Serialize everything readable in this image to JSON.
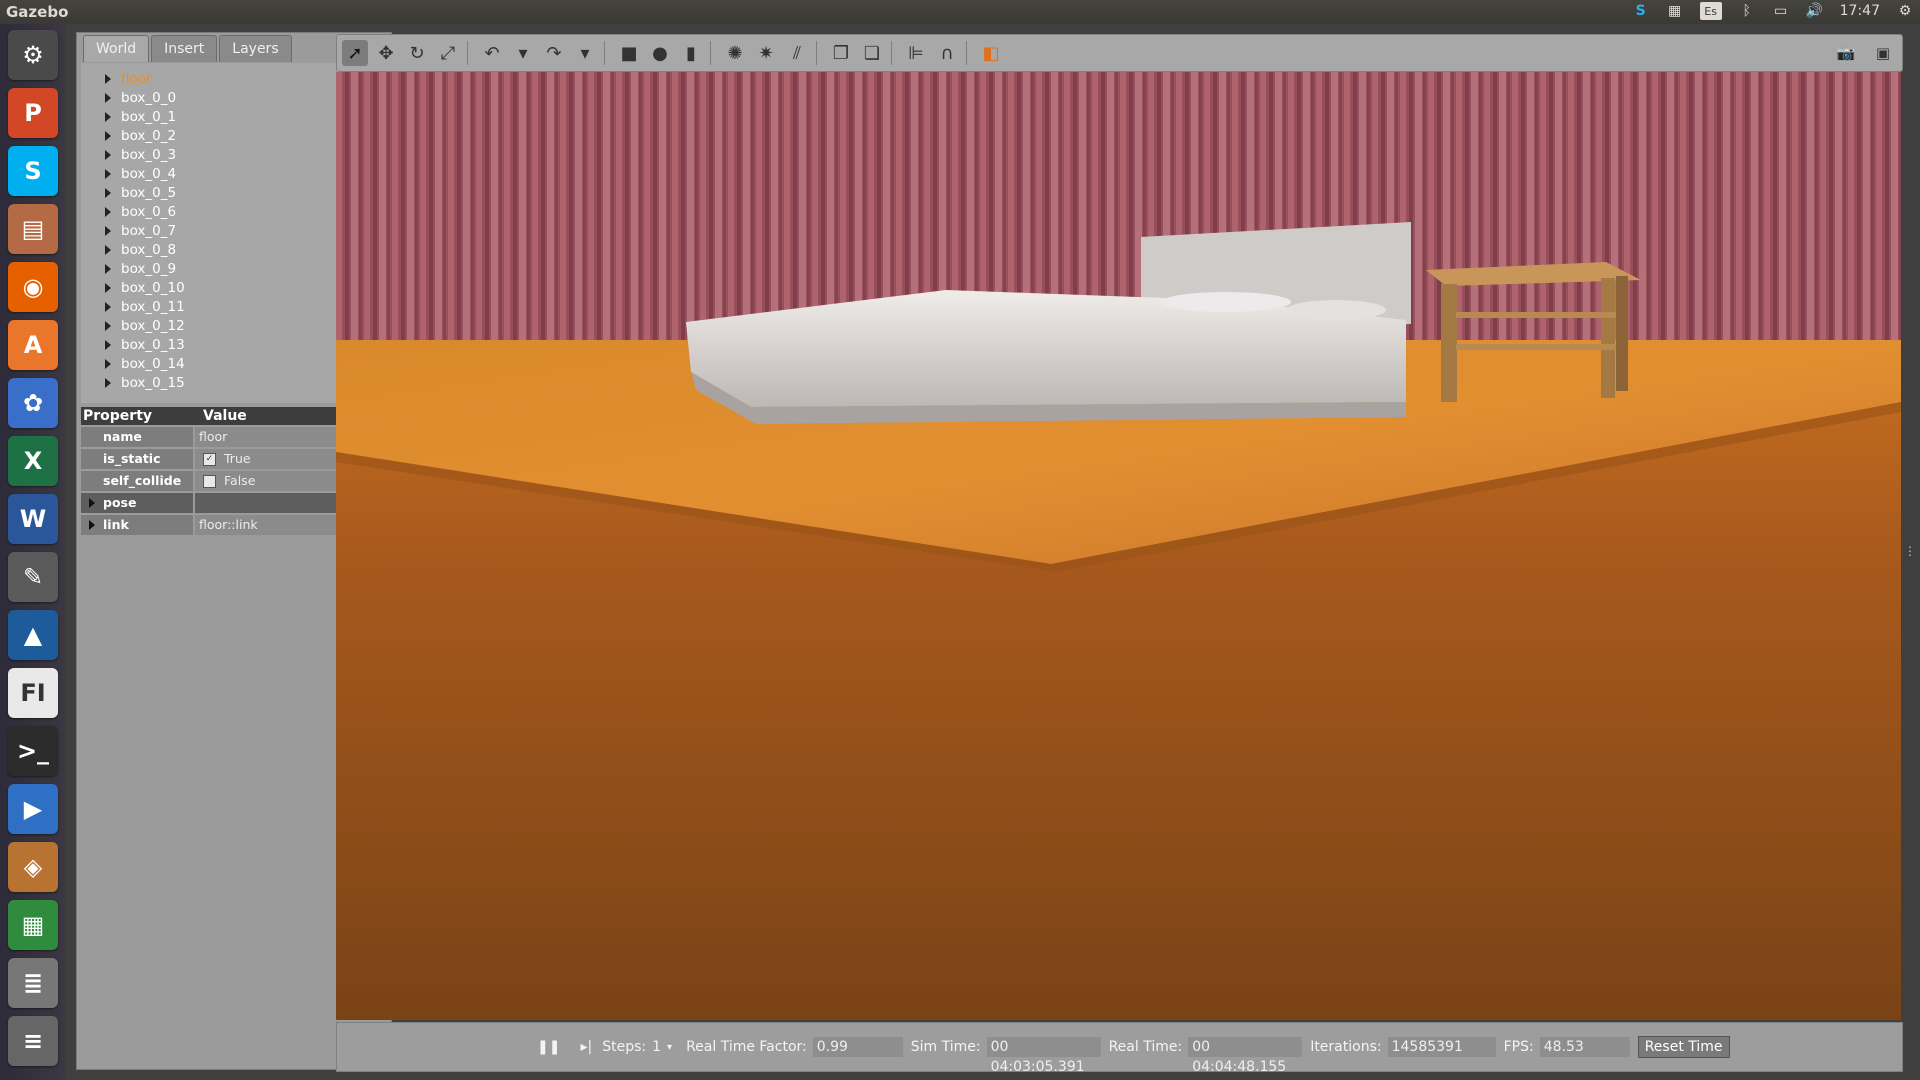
{
  "topbar": {
    "app_title": "Gazebo",
    "keyboard_layout": "Es",
    "clock": "17:47"
  },
  "launcher": [
    {
      "name": "system-settings-icon",
      "glyph": "⚙",
      "color": "#4a4a4a"
    },
    {
      "name": "powerpoint-icon",
      "glyph": "P",
      "color": "#d24726"
    },
    {
      "name": "skype-icon",
      "glyph": "S",
      "color": "#00aff0"
    },
    {
      "name": "files-icon",
      "glyph": "▤",
      "color": "#b46a45"
    },
    {
      "name": "firefox-icon",
      "glyph": "◉",
      "color": "#e66000"
    },
    {
      "name": "software-center-icon",
      "glyph": "A",
      "color": "#e9762b"
    },
    {
      "name": "photos-icon",
      "glyph": "✿",
      "color": "#3a6fc9"
    },
    {
      "name": "excel-icon",
      "glyph": "X",
      "color": "#1e7145"
    },
    {
      "name": "word-icon",
      "glyph": "W",
      "color": "#2b579a"
    },
    {
      "name": "tools-icon",
      "glyph": "✎",
      "color": "#5a5a5a"
    },
    {
      "name": "matlab-icon",
      "glyph": "▲",
      "color": "#1e5b9a"
    },
    {
      "name": "fi-ed-icon",
      "glyph": "FI",
      "color": "#e9e9e9"
    },
    {
      "name": "terminal-icon",
      "glyph": ">_",
      "color": "#2c2c2c"
    },
    {
      "name": "media-player-icon",
      "glyph": "▶",
      "color": "#2f6fc4"
    },
    {
      "name": "virtualbox-icon",
      "glyph": "◈",
      "color": "#b87333"
    },
    {
      "name": "spreadsheet-icon",
      "glyph": "▦",
      "color": "#2f8c3e"
    },
    {
      "name": "stacked-apps-icon",
      "glyph": "≣",
      "color": "#777"
    },
    {
      "name": "trash-icon",
      "glyph": "≡",
      "color": "#666"
    }
  ],
  "left_panel": {
    "tabs": [
      {
        "label": "World",
        "active": true
      },
      {
        "label": "Insert",
        "active": false
      },
      {
        "label": "Layers",
        "active": false
      }
    ],
    "tree_items": [
      {
        "label": "floor",
        "selected": true
      },
      {
        "label": "box_0_0"
      },
      {
        "label": "box_0_1"
      },
      {
        "label": "box_0_2"
      },
      {
        "label": "box_0_3"
      },
      {
        "label": "box_0_4"
      },
      {
        "label": "box_0_5"
      },
      {
        "label": "box_0_6"
      },
      {
        "label": "box_0_7"
      },
      {
        "label": "box_0_8"
      },
      {
        "label": "box_0_9"
      },
      {
        "label": "box_0_10"
      },
      {
        "label": "box_0_11"
      },
      {
        "label": "box_0_12"
      },
      {
        "label": "box_0_13"
      },
      {
        "label": "box_0_14"
      },
      {
        "label": "box_0_15"
      }
    ],
    "properties": {
      "header_property": "Property",
      "header_value": "Value",
      "rows": {
        "name": {
          "key": "name",
          "value": "floor"
        },
        "is_static": {
          "key": "is_static",
          "value": "True",
          "checked": true
        },
        "self_collide": {
          "key": "self_collide",
          "value": "False",
          "checked": false
        },
        "pose": {
          "key": "pose",
          "value": ""
        },
        "link": {
          "key": "link",
          "value": "floor::link"
        }
      }
    }
  },
  "toolbar": {
    "tools": [
      {
        "name": "select-mode-icon",
        "glyph": "➚",
        "active": true
      },
      {
        "name": "translate-mode-icon",
        "glyph": "✥"
      },
      {
        "name": "rotate-mode-icon",
        "glyph": "↻"
      },
      {
        "name": "scale-mode-icon",
        "glyph": "⤢"
      },
      {
        "name": "sep"
      },
      {
        "name": "undo-icon",
        "glyph": "↶"
      },
      {
        "name": "undo-history-icon",
        "glyph": "▾"
      },
      {
        "name": "redo-icon",
        "glyph": "↷"
      },
      {
        "name": "redo-history-icon",
        "glyph": "▾"
      },
      {
        "name": "sep"
      },
      {
        "name": "box-shape-icon",
        "glyph": "■"
      },
      {
        "name": "sphere-shape-icon",
        "glyph": "●"
      },
      {
        "name": "cylinder-shape-icon",
        "glyph": "▮"
      },
      {
        "name": "sep"
      },
      {
        "name": "point-light-icon",
        "glyph": "✺"
      },
      {
        "name": "spot-light-icon",
        "glyph": "✷"
      },
      {
        "name": "directional-light-icon",
        "glyph": "⫽"
      },
      {
        "name": "sep"
      },
      {
        "name": "copy-icon",
        "glyph": "❐"
      },
      {
        "name": "paste-icon",
        "glyph": "❏"
      },
      {
        "name": "sep"
      },
      {
        "name": "align-icon",
        "glyph": "⊫"
      },
      {
        "name": "snap-icon",
        "glyph": "∩"
      },
      {
        "name": "sep"
      },
      {
        "name": "view-angle-icon",
        "glyph": "◧"
      }
    ],
    "right_tools": [
      {
        "name": "screenshot-icon",
        "glyph": "📷"
      },
      {
        "name": "record-log-icon",
        "glyph": "▣"
      }
    ]
  },
  "status_bar": {
    "steps_label": "Steps:",
    "steps_value": "1",
    "rtf_label": "Real Time Factor:",
    "rtf_value": "0.99",
    "sim_time_label": "Sim Time:",
    "sim_time_value": "00 04:03:05.391",
    "real_time_label": "Real Time:",
    "real_time_value": "00 04:04:48.155",
    "iterations_label": "Iterations:",
    "iterations_value": "14585391",
    "fps_label": "FPS:",
    "fps_value": "48.53",
    "reset_label": "Reset Time"
  }
}
